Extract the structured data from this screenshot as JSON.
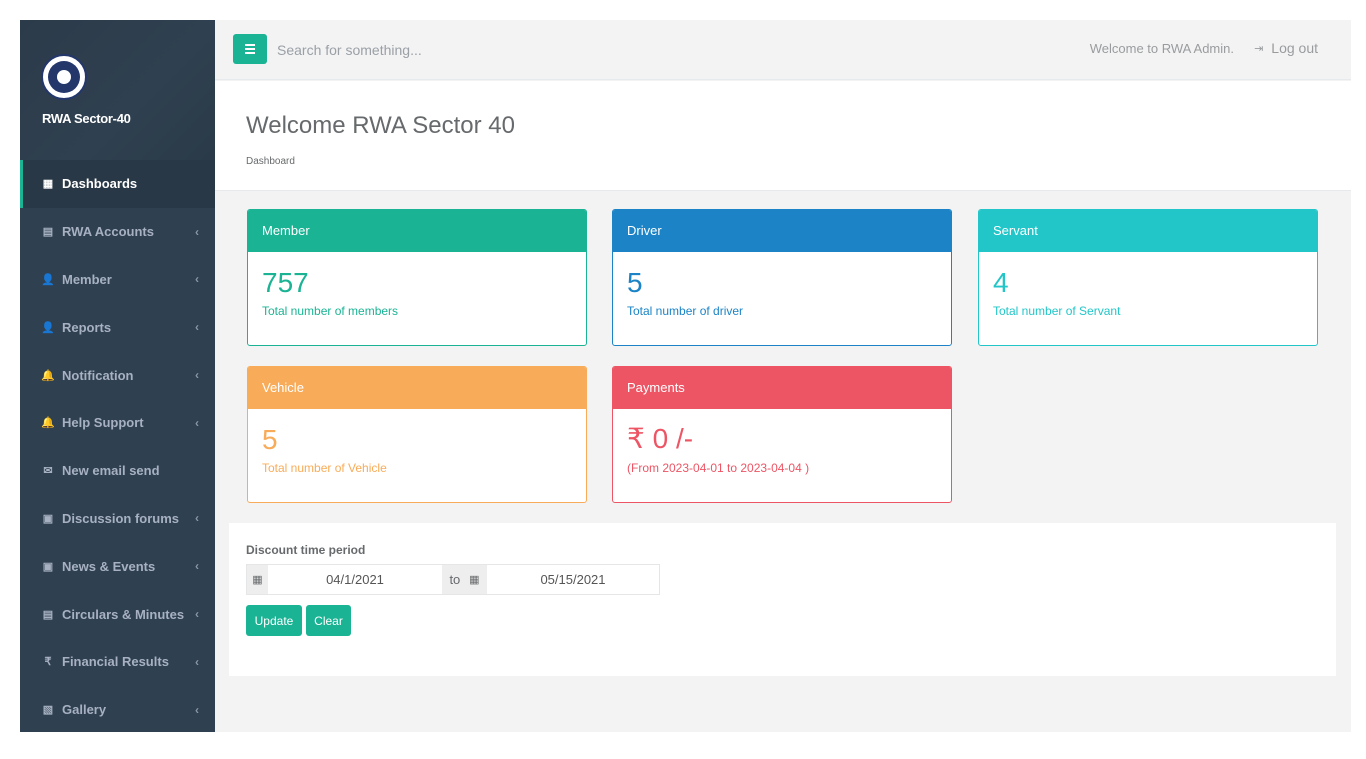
{
  "sidebar": {
    "brand": "RWA Sector-40",
    "items": [
      {
        "label": "Dashboards",
        "icon": "th-large-icon",
        "glyph": "▦",
        "active": true,
        "has_children": false
      },
      {
        "label": "RWA Accounts",
        "icon": "calculator-icon",
        "glyph": "▤",
        "active": false,
        "has_children": true
      },
      {
        "label": "Member",
        "icon": "user-icon",
        "glyph": "👤",
        "active": false,
        "has_children": true
      },
      {
        "label": "Reports",
        "icon": "user-icon",
        "glyph": "👤",
        "active": false,
        "has_children": true
      },
      {
        "label": "Notification",
        "icon": "bell-icon",
        "glyph": "🔔",
        "active": false,
        "has_children": true
      },
      {
        "label": "Help Support",
        "icon": "bell-icon",
        "glyph": "🔔",
        "active": false,
        "has_children": true
      },
      {
        "label": "New email send",
        "icon": "envelope-icon",
        "glyph": "✉",
        "active": false,
        "has_children": false
      },
      {
        "label": "Discussion forums",
        "icon": "newspaper-icon",
        "glyph": "▣",
        "active": false,
        "has_children": true
      },
      {
        "label": "News & Events",
        "icon": "newspaper-icon",
        "glyph": "▣",
        "active": false,
        "has_children": true
      },
      {
        "label": "Circulars & Minutes",
        "icon": "file-text-icon",
        "glyph": "▤",
        "active": false,
        "has_children": true
      },
      {
        "label": "Financial Results",
        "icon": "rupee-icon",
        "glyph": "₹",
        "active": false,
        "has_children": true
      },
      {
        "label": "Gallery",
        "icon": "image-icon",
        "glyph": "▧",
        "active": false,
        "has_children": true
      }
    ],
    "chevron": "‹"
  },
  "topbar": {
    "search_placeholder": "Search for something...",
    "welcome": "Welcome to RWA Admin.",
    "logout": "Log out"
  },
  "heading": {
    "title": "Welcome RWA Sector 40",
    "breadcrumb": "Dashboard"
  },
  "cards": {
    "member": {
      "title": "Member",
      "value": "757",
      "sub": "Total number of members",
      "color": "#1ab394"
    },
    "driver": {
      "title": "Driver",
      "value": "5",
      "sub": "Total number of driver",
      "color": "#1c84c6"
    },
    "servant": {
      "title": "Servant",
      "value": "4",
      "sub": "Total number of Servant",
      "color": "#23c6c8"
    },
    "vehicle": {
      "title": "Vehicle",
      "value": "5",
      "sub": "Total number of Vehicle",
      "color": "#f8ac59"
    },
    "payments": {
      "title": "Payments",
      "value": "₹ 0 /-",
      "sub": "(From 2023-04-01 to 2023-04-04 )",
      "color": "#ed5565"
    }
  },
  "discount": {
    "title": "Discount time period",
    "from": "04/1/2021",
    "to_label": "to",
    "to": "05/15/2021",
    "update_label": "Update",
    "clear_label": "Clear"
  },
  "colors": {
    "sidebar_bg": "#2f4050",
    "accent": "#1ab394"
  }
}
